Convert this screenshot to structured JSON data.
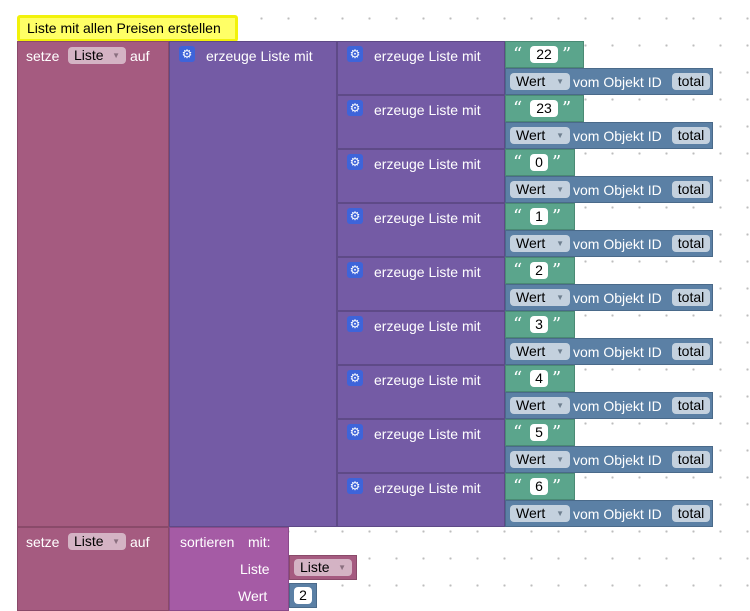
{
  "comment": {
    "text": "Liste mit allen Preisen erstellen"
  },
  "set1": {
    "label_setze": "setze",
    "variable": "Liste",
    "label_auf": "auf"
  },
  "outer_list": {
    "label": "erzeuge Liste mit"
  },
  "inner_label": "erzeuge Liste mit",
  "object_label": "vom Objekt ID",
  "wert_label": "Wert",
  "items": [
    {
      "text": "22",
      "field": "total"
    },
    {
      "text": "23",
      "field": "total"
    },
    {
      "text": "0",
      "field": "total"
    },
    {
      "text": "1",
      "field": "total"
    },
    {
      "text": "2",
      "field": "total"
    },
    {
      "text": "3",
      "field": "total"
    },
    {
      "text": "4",
      "field": "total"
    },
    {
      "text": "5",
      "field": "total"
    },
    {
      "text": "6",
      "field": "total"
    }
  ],
  "set2": {
    "label_setze": "setze",
    "variable": "Liste",
    "label_auf": "auf"
  },
  "sort": {
    "label_sortieren": "sortieren",
    "label_mit": "mit:",
    "label_liste": "Liste",
    "list_var": "Liste",
    "label_wert": "Wert",
    "wert_value": "2"
  },
  "colors": {
    "variables": "#a55b80",
    "lists": "#745ba5",
    "text": "#5ba58c",
    "objects": "#5b80a5",
    "sort": "#a55ba5",
    "comment": "#ffff66"
  },
  "icons": {
    "mutator": "gear-icon"
  }
}
